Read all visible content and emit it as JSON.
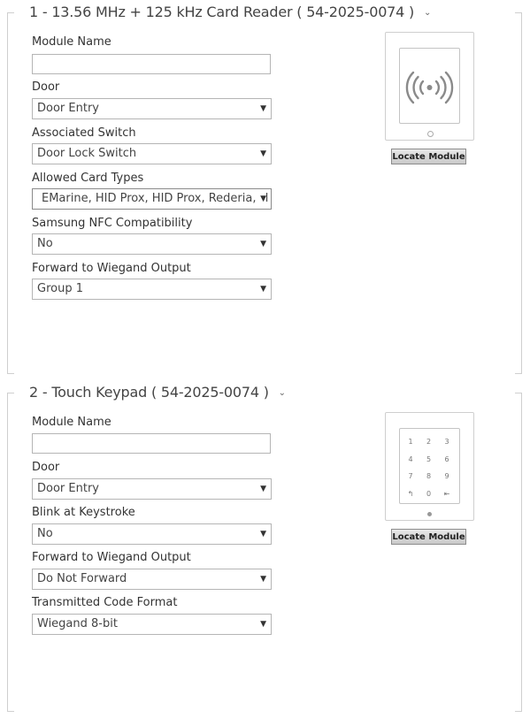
{
  "module1": {
    "legend": "1 - 13.56 MHz + 125 kHz Card Reader ( 54-2025-0074 )",
    "fields": {
      "module_name_label": "Module Name",
      "module_name_value": "",
      "door_label": "Door",
      "door_value": "Door Entry",
      "switch_label": "Associated Switch",
      "switch_value": "Door Lock Switch",
      "card_types_label": "Allowed Card Types",
      "card_types_value": "EMarine, HID Prox, HID Prox, Rederia, H",
      "samsung_label": "Samsung NFC Compatibility",
      "samsung_value": "No",
      "wiegand_label": "Forward to Wiegand Output",
      "wiegand_value": "Group 1"
    },
    "locate_label": "Locate Module",
    "device_icon": "rfid-reader-icon"
  },
  "module2": {
    "legend": "2 - Touch Keypad ( 54-2025-0074 )",
    "fields": {
      "module_name_label": "Module Name",
      "module_name_value": "",
      "door_label": "Door",
      "door_value": "Door Entry",
      "blink_label": "Blink at Keystroke",
      "blink_value": "No",
      "wiegand_label": "Forward to Wiegand Output",
      "wiegand_value": "Do Not Forward",
      "code_format_label": "Transmitted Code Format",
      "code_format_value": "Wiegand 8-bit"
    },
    "locate_label": "Locate Module",
    "keys": [
      "1",
      "2",
      "3",
      "4",
      "5",
      "6",
      "7",
      "8",
      "9",
      "↰",
      "0",
      "⇤"
    ],
    "device_icon": "keypad-icon"
  },
  "icons": {
    "dropdown": "▼",
    "collapse": "⌄"
  },
  "colors": {
    "border": "#b5b5b5",
    "section_border": "#cfcfcf",
    "text": "#333333"
  }
}
